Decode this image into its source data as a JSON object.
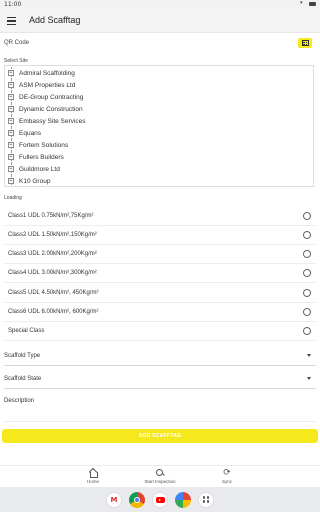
{
  "status_bar": {
    "time": "11:00",
    "icons": [
      "wifi-icon",
      "battery-icon"
    ]
  },
  "app_bar": {
    "title": "Add Scafftag",
    "menu_icon": "menu-icon"
  },
  "qr": {
    "label": "QR Code",
    "button_icon": "qr-code-icon"
  },
  "site": {
    "label": "Select Site",
    "items": [
      "Admiral Scaffolding",
      "ASM Properties Ltd",
      "DE-Group Contracting",
      "Dynamic Construction",
      "Embassy Site Services",
      "Equans",
      "Fortem Solutions",
      "Fullers Builders",
      "Guildmore Ltd",
      "K10 Group"
    ]
  },
  "loading": {
    "label": "Loading",
    "options": [
      "Class1 UDL 0.75kN/m²,75Kg/m²",
      "Class2 UDL 1.50kN/m²,150Kg/m²",
      "Class3 UDL 2.00kN/m²,200Kg/m²",
      "Class4 UDL 3.00kN/m²,300Kg/m²",
      "Class5 UDL 4.50kN/m², 450Kg/m²",
      "Class6 UDL 6.00kN/m², 600Kg/m²",
      "Special Class"
    ]
  },
  "scaffold_type": {
    "label": "Scaffold Type"
  },
  "scaffold_state": {
    "label": "Scaffold State"
  },
  "description": {
    "label": "Description"
  },
  "add_button": {
    "label": "ADD SCAFFTAG"
  },
  "bottom_nav": {
    "items": [
      {
        "label": "Home",
        "icon": "home-icon"
      },
      {
        "label": "Start Inspection",
        "icon": "search-icon"
      },
      {
        "label": "Sync",
        "icon": "sync-icon"
      }
    ]
  },
  "system_apps": [
    "gmail-icon",
    "chrome-icon",
    "youtube-icon",
    "photos-icon",
    "apps-icon"
  ],
  "colors": {
    "accent": "#f5e81c",
    "app_bar_bg": "#f4f4f4",
    "system_bar_bg": "#e9eaee"
  }
}
